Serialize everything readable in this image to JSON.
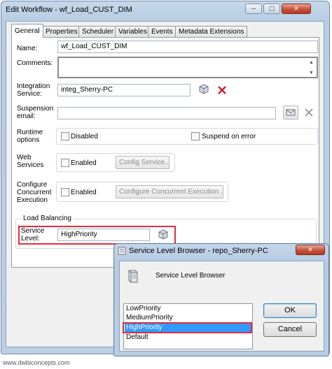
{
  "main_window": {
    "title": "Edit Workflow - wf_Load_CUST_DIM",
    "caption_buttons": {
      "minimize": "─",
      "maximize": "▢",
      "close": "✕"
    }
  },
  "tabs": [
    {
      "label": "General"
    },
    {
      "label": "Properties"
    },
    {
      "label": "Scheduler"
    },
    {
      "label": "Variables"
    },
    {
      "label": "Events"
    },
    {
      "label": "Metadata Extensions"
    }
  ],
  "form": {
    "name_label": "Name:",
    "name_value": "wf_Load_CUST_DIM",
    "comments_label": "Comments:",
    "comments_value": "",
    "integration_label_1": "Integration",
    "integration_label_2": "Service:",
    "integration_value": "integ_Sherry-PC",
    "suspension_label_1": "Suspension",
    "suspension_label_2": "email:",
    "suspension_value": "",
    "runtime_label_1": "Runtime",
    "runtime_label_2": "options",
    "disabled_label": "Disabled",
    "suspend_label": "Suspend on error",
    "web_label_1": "Web",
    "web_label_2": "Services",
    "web_enabled_label": "Enabled",
    "config_service_button": "Config Service...",
    "configure_label_1": "Configure",
    "configure_label_2": "Concurrent",
    "configure_label_3": "Execution",
    "concurrent_enabled_label": "Enabled",
    "configure_concurrent_button": "Configure Concurrent Execution ...",
    "load_balancing_label": "Load Balancing",
    "service_level_label_1": "Service",
    "service_level_label_2": "Level:",
    "service_level_value": "HighPriority"
  },
  "dialog": {
    "title": "Service Level Browser - repo_Sherry-PC",
    "heading": "Service Level Browser",
    "close": "✕",
    "items": [
      {
        "label": "LowPriority"
      },
      {
        "label": "MediumPriority"
      },
      {
        "label": "HighPriority"
      },
      {
        "label": "Default"
      }
    ],
    "selected_index": 2,
    "ok_label": "OK",
    "cancel_label": "Cancel"
  },
  "watermark": "www.dwbiconcepts.com",
  "colors": {
    "highlight_border": "#e0303c",
    "selection": "#3399ff",
    "title_bar": "#bcd0e5"
  },
  "icons": {
    "browse": "server-cube-icon",
    "clear": "red-x-icon",
    "email": "email-icon",
    "dialog_header": "server-icon"
  }
}
